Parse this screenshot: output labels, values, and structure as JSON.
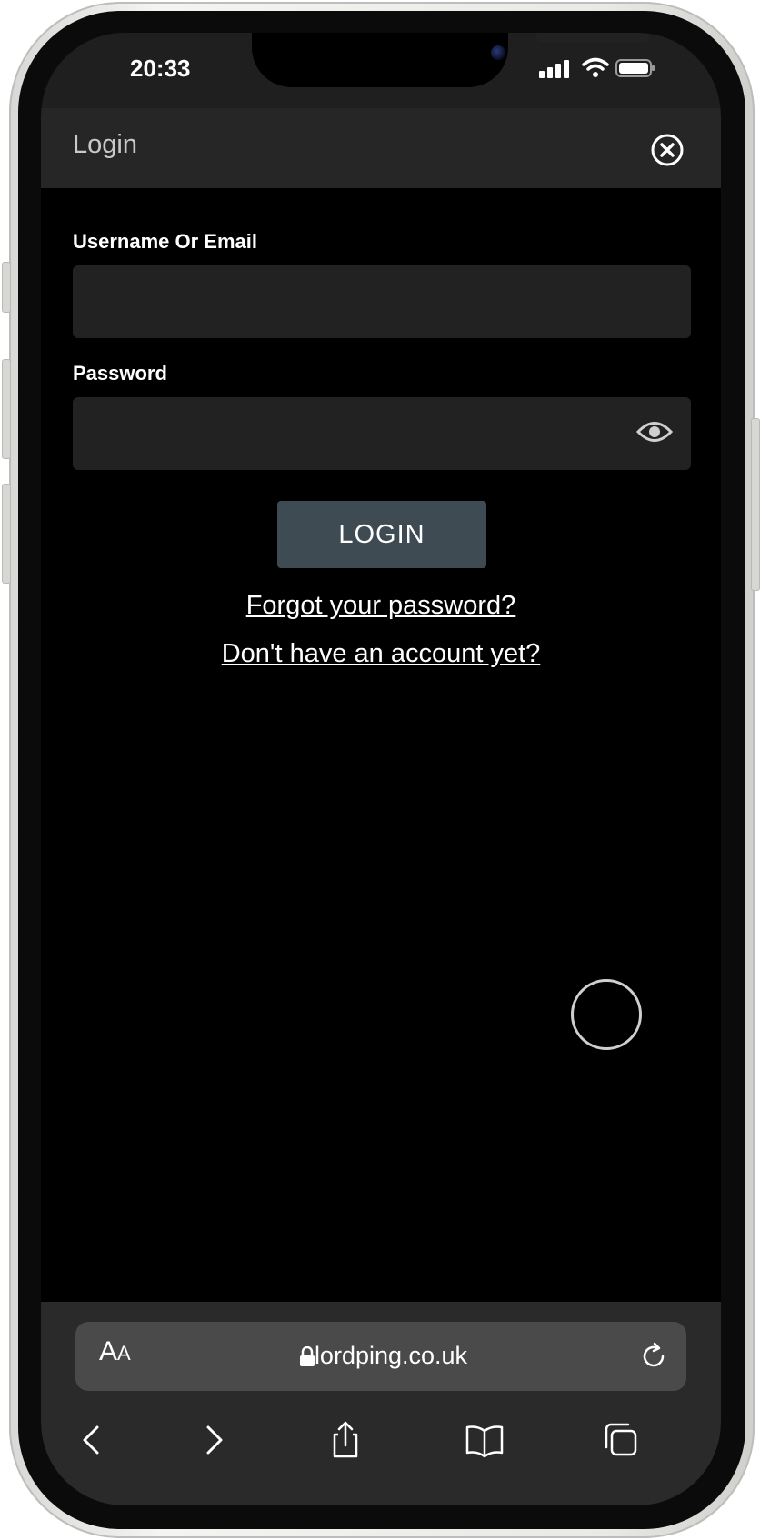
{
  "status_bar": {
    "time": "20:33"
  },
  "dialog": {
    "title": "Login",
    "username_label": "Username Or Email",
    "username_value": "",
    "password_label": "Password",
    "password_value": "",
    "login_button": "LOGIN",
    "forgot_link": "Forgot your password?",
    "signup_link": "Don't have an account yet?"
  },
  "browser": {
    "text_size_big": "A",
    "text_size_small": "A",
    "url": "lordping.co.uk"
  },
  "colors": {
    "background": "#000000",
    "header": "#262626",
    "input": "#222222",
    "button": "#3f4b53",
    "toolbar": "#2a2a2a"
  }
}
